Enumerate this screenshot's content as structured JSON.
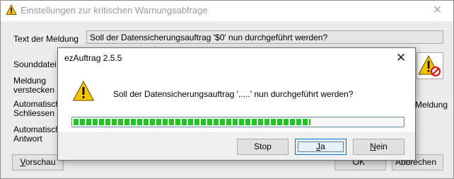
{
  "background_window": {
    "title": "Einstellungen zur kritischen Warnungsabfrage",
    "close_glyph": "✕",
    "labels": {
      "message_text": "Text der Meldung",
      "sound_file": "Sounddatei",
      "hide_message_l1": "Meldung",
      "hide_message_l2": "verstecken",
      "auto_close_l1": "Automatische",
      "auto_close_l2": "Schliessen",
      "auto_answer_l1": "Automatische",
      "auto_answer_l2": "Antwort"
    },
    "message_field_value": "Soll der Datensicherungsauftrag '$0' nun durchgeführt werden?",
    "right_text_partial": "Meldung",
    "preview_button": {
      "label_rest": "orschau",
      "mnemonic": "V"
    },
    "ok_button_partial": "OK",
    "cancel_button_partial": "Abbrechen"
  },
  "dialog": {
    "title": "ezAuftrag 2.5.5",
    "close_glyph": "✕",
    "message": "Soll der Datensicherungsauftrag '.....' nun durchgeführt werden?",
    "progress_fraction": 0.72,
    "buttons": {
      "stop": "Stop",
      "yes": {
        "mnemonic": "J",
        "rest": "a"
      },
      "no": {
        "mnemonic": "N",
        "rest": "ein"
      }
    }
  },
  "colors": {
    "progress_green": "#22c322",
    "focus_blue": "#0078d7",
    "warning_yellow": "#f5c400"
  },
  "icons": {
    "warning": "warning-icon",
    "no_sound": "no-sound-icon"
  }
}
